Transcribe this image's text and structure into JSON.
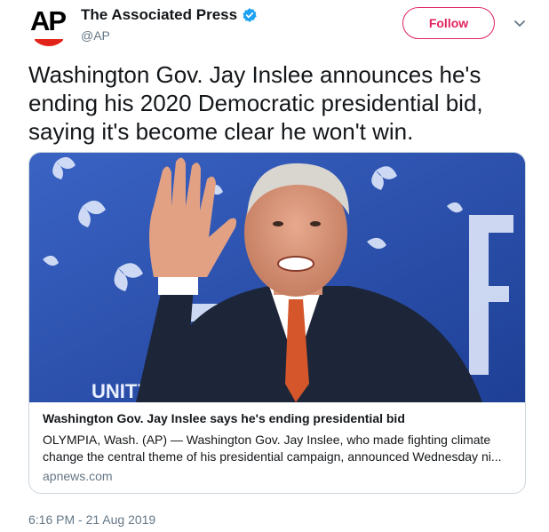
{
  "author": {
    "display_name": "The Associated Press",
    "handle": "@AP",
    "avatar_text": "AP",
    "verified": true
  },
  "follow_label": "Follow",
  "tweet_text": "Washington Gov. Jay Inslee announces he's ending his 2020 Democratic presidential bid, saying it's become clear he won't win.",
  "card": {
    "image_sign_text": "UNITY + FR",
    "title": "Washington Gov. Jay Inslee says he's ending presidential bid",
    "description": "OLYMPIA, Wash. (AP) — Washington Gov. Jay Inslee, who made fighting climate change the central theme of his presidential campaign, announced Wednesday ni...",
    "domain": "apnews.com"
  },
  "timestamp": "6:16 PM - 21 Aug 2019",
  "colors": {
    "brand_red": "#e2231a",
    "follow_accent": "#e0245e",
    "verified_blue": "#1da1f2",
    "muted_text": "#657786",
    "stage_blue": "#2a4fb0"
  }
}
